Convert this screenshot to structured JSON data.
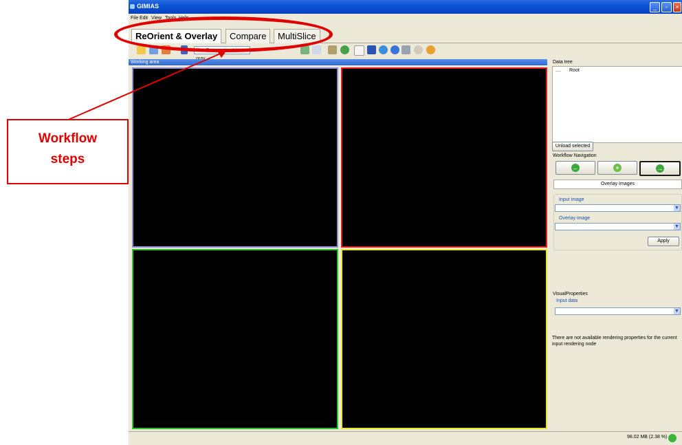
{
  "window": {
    "title": "GIMIAS"
  },
  "menu": {
    "items": [
      "File",
      "Edit",
      "View",
      "Tools",
      "Help"
    ]
  },
  "tabs": [
    {
      "label": "ReOrient & Overlay",
      "active": true
    },
    {
      "label": "Compare",
      "active": false
    },
    {
      "label": "MultiSlice",
      "active": false
    }
  ],
  "toolbar": {
    "lut_value": "Non Perspective Lin. gray"
  },
  "working_area": {
    "title": "Working area",
    "view_border_colors": [
      "#8f8fd0",
      "#e02020",
      "#2bc52b",
      "#e8e82a"
    ]
  },
  "data_tree": {
    "title": "Data tree",
    "root_label": "Root",
    "unload_button": "Unload selected"
  },
  "workflow_nav": {
    "title": "Workflow Navigation",
    "step_name": "Overlay Images",
    "input_image_label": "Input image",
    "overlay_image_label": "Overlay image",
    "apply_button": "Apply"
  },
  "visual_properties": {
    "title": "VisualProperties",
    "input_data_label": "Input data",
    "message": "There are not available rendering properties for the current input rendering node"
  },
  "status": {
    "memory": "98.02 MB (2.38 %)"
  },
  "annotation": {
    "line1": "Workflow",
    "line2": "steps",
    "color": "#e00000"
  }
}
